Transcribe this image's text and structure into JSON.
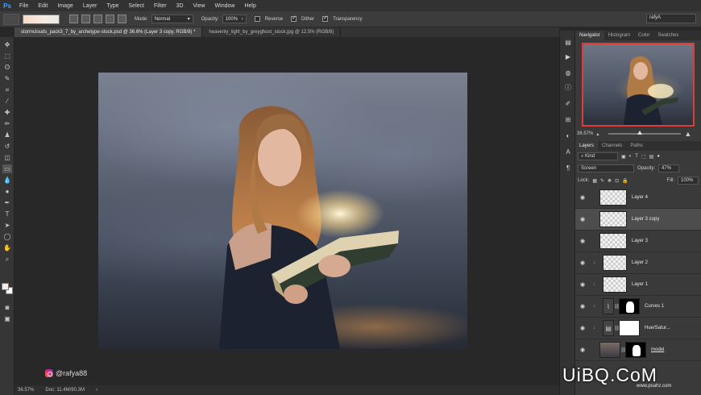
{
  "app": {
    "logo": "Ps"
  },
  "menu": [
    "File",
    "Edit",
    "Image",
    "Layer",
    "Type",
    "Select",
    "Filter",
    "3D",
    "View",
    "Window",
    "Help"
  ],
  "options": {
    "mode_label": "Mode:",
    "mode_value": "Normal",
    "opacity_label": "Opacity:",
    "opacity_value": "100%",
    "reverse_label": "Reverse",
    "dither_label": "Dither",
    "transparency_label": "Transparency",
    "workspace": "rafyA"
  },
  "tabs": [
    {
      "label": "stormclouds_pack3_7_by_archetype-stock.psd @ 36.6% (Layer 3 copy, RGB/8) *",
      "active": true
    },
    {
      "label": "heavenly_light_by_greyghost_stock.jpg @ 12.5% (RGB/8)",
      "active": false
    }
  ],
  "tools": [
    "move-icon",
    "marquee-icon",
    "lasso-icon",
    "quick-select-icon",
    "crop-icon",
    "eyedropper-icon",
    "healing-icon",
    "brush-icon",
    "stamp-icon",
    "history-brush-icon",
    "eraser-icon",
    "gradient-icon",
    "blur-icon",
    "dodge-icon",
    "pen-icon",
    "type-icon",
    "path-select-icon",
    "shape-icon",
    "hand-icon",
    "zoom-icon"
  ],
  "canvas": {
    "watermark": "@rafya88"
  },
  "status": {
    "zoom": "36.57%",
    "doc": "Doc: 11.4M/90.3M"
  },
  "navigator": {
    "tabs": [
      "Navigator",
      "Histogram",
      "Color",
      "Swatches"
    ],
    "zoom": "36.57%"
  },
  "layers_panel": {
    "tabs": [
      "Layers",
      "Channels",
      "Paths"
    ],
    "filter_kind": "Kind",
    "blend_mode": "Screen",
    "opacity_label": "Opacity:",
    "opacity_value": "47%",
    "lock_label": "Lock:",
    "fill_label": "Fill:",
    "fill_value": "100%",
    "layers": [
      {
        "name": "Layer 4",
        "type": "pixel",
        "clipped": false,
        "selected": false
      },
      {
        "name": "Layer 3 copy",
        "type": "pixel",
        "clipped": false,
        "selected": true
      },
      {
        "name": "Layer 3",
        "type": "pixel",
        "clipped": false,
        "selected": false
      },
      {
        "name": "Layer 2",
        "type": "pixel",
        "clipped": true,
        "selected": false
      },
      {
        "name": "Layer 1",
        "type": "pixel",
        "clipped": true,
        "selected": false
      },
      {
        "name": "Curves 1",
        "type": "curves",
        "clipped": true,
        "selected": false
      },
      {
        "name": "Hue/Satur...",
        "type": "hue",
        "clipped": true,
        "selected": false
      },
      {
        "name": "model",
        "type": "photo",
        "clipped": false,
        "selected": false
      }
    ]
  },
  "brand": {
    "name": "UiBQ.CoM",
    "sub": "www.psahz.com"
  }
}
